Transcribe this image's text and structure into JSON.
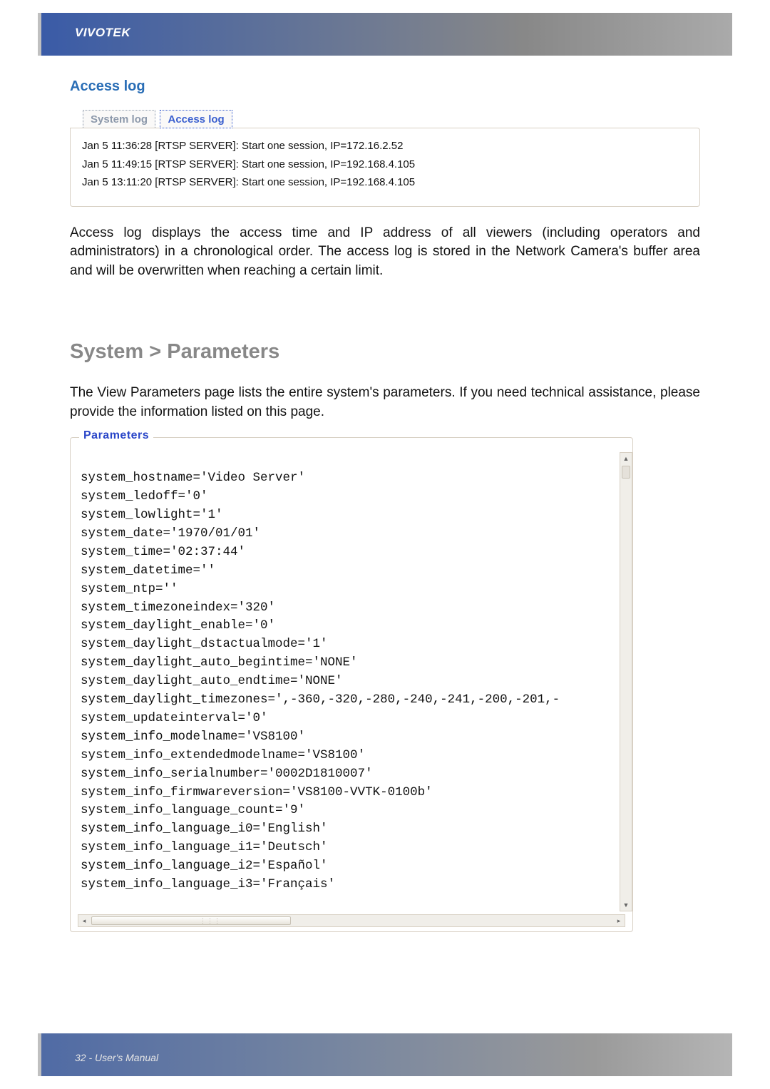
{
  "brand": "VIVOTEK",
  "footer": "32 - User's Manual",
  "access_log": {
    "title": "Access log",
    "tabs": {
      "system": "System log",
      "access": "Access log"
    },
    "lines": [
      "Jan 5 11:36:28 [RTSP SERVER]: Start one session, IP=172.16.2.52",
      "Jan 5 11:49:15 [RTSP SERVER]: Start one session, IP=192.168.4.105",
      "Jan 5 13:11:20 [RTSP SERVER]: Start one session, IP=192.168.4.105"
    ],
    "description": "Access log displays the access time and IP address of all viewers (including operators and administrators) in a chronological order. The access log is stored in the Network Camera's buffer area and will be overwritten when reaching a certain limit."
  },
  "parameters_section": {
    "heading": "System > Parameters",
    "description": "The View Parameters page lists the entire system's parameters. If you need technical assistance, please provide the information listed on this page.",
    "legend": "Parameters",
    "lines": [
      "system_hostname='Video Server'",
      "system_ledoff='0'",
      "system_lowlight='1'",
      "system_date='1970/01/01'",
      "system_time='02:37:44'",
      "system_datetime=''",
      "system_ntp=''",
      "system_timezoneindex='320'",
      "system_daylight_enable='0'",
      "system_daylight_dstactualmode='1'",
      "system_daylight_auto_begintime='NONE'",
      "system_daylight_auto_endtime='NONE'",
      "system_daylight_timezones=',-360,-320,-280,-240,-241,-200,-201,-",
      "system_updateinterval='0'",
      "system_info_modelname='VS8100'",
      "system_info_extendedmodelname='VS8100'",
      "system_info_serialnumber='0002D1810007'",
      "system_info_firmwareversion='VS8100-VVTK-0100b'",
      "system_info_language_count='9'",
      "system_info_language_i0='English'",
      "system_info_language_i1='Deutsch'",
      "system_info_language_i2='Español'",
      "system_info_language_i3='Français'"
    ]
  }
}
